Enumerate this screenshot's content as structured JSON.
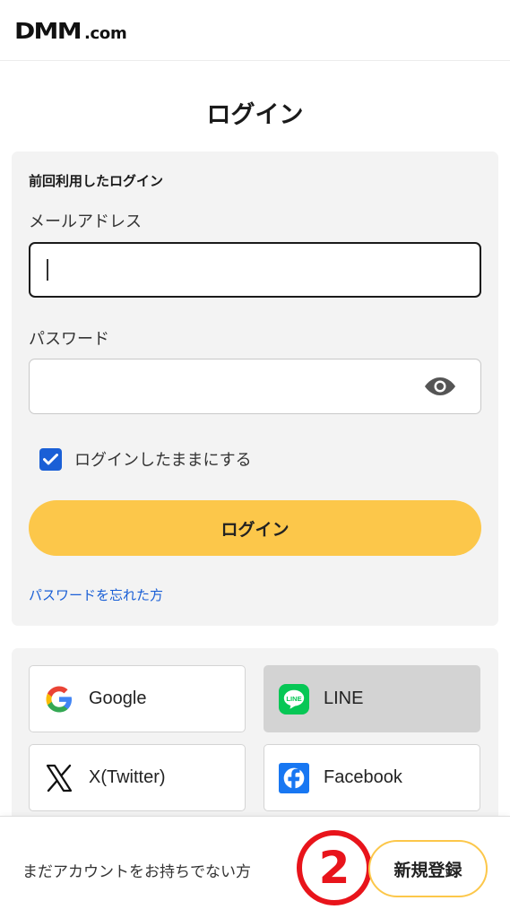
{
  "header": {
    "logo_main": "DMM",
    "logo_suffix": ".com"
  },
  "page": {
    "title": "ログイン"
  },
  "login_form": {
    "section_label": "前回利用したログイン",
    "email_label": "メールアドレス",
    "email_value": "",
    "password_label": "パスワード",
    "password_value": "",
    "keep_logged_in_label": "ログインしたままにする",
    "keep_logged_in_checked": true,
    "login_button": "ログイン",
    "forgot_password_link": "パスワードを忘れた方"
  },
  "social_login": [
    {
      "label": "Google",
      "icon": "google-icon"
    },
    {
      "label": "LINE",
      "icon": "line-icon"
    },
    {
      "label": "X(Twitter)",
      "icon": "x-twitter-icon"
    },
    {
      "label": "Facebook",
      "icon": "facebook-icon"
    }
  ],
  "footer": {
    "no_account_text": "まだアカウントをお持ちでない方",
    "register_button": "新規登録",
    "step_marker": "2"
  },
  "colors": {
    "accent_yellow": "#fcc74a",
    "link_blue": "#1a5fd6",
    "checkbox_blue": "#1a5fd6",
    "line_green": "#06c755",
    "facebook_blue": "#1877f2",
    "marker_red": "#e8141b"
  }
}
